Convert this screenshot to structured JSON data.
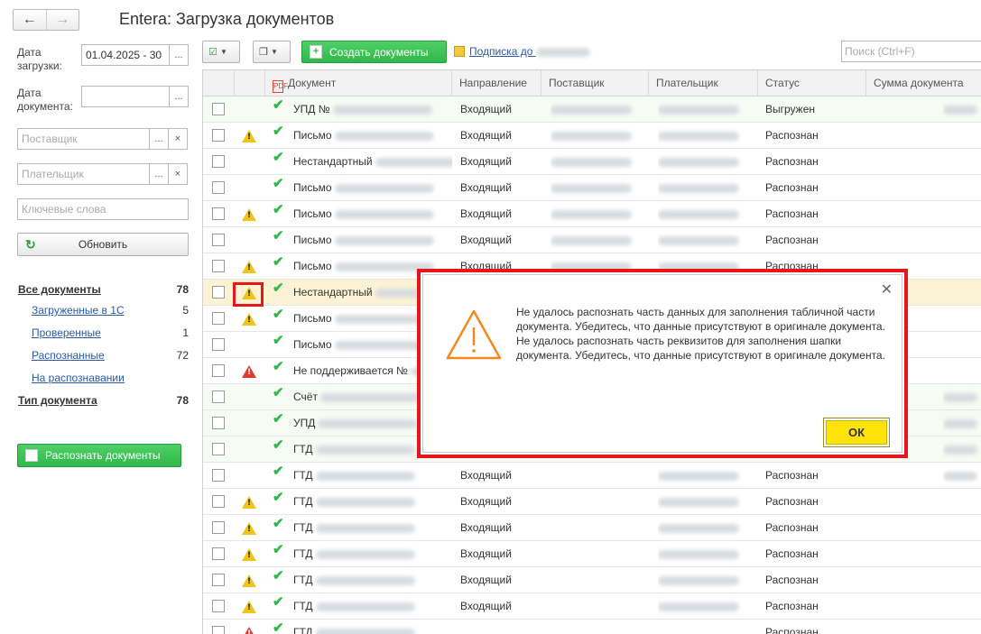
{
  "window": {
    "title": "Entera: Загрузка документов"
  },
  "filters": {
    "upload_date_label": "Дата загрузки:",
    "upload_date_value": "01.04.2025 - 30",
    "doc_date_label": "Дата документа:",
    "supplier_placeholder": "Поставщик",
    "payer_placeholder": "Плательщик",
    "keywords_placeholder": "Ключевые слова",
    "refresh_label": "Обновить"
  },
  "nav": {
    "all_docs": {
      "label": "Все документы",
      "count": "78"
    },
    "sub": [
      {
        "label": "Загруженные в 1С",
        "count": "5"
      },
      {
        "label": "Проверенные",
        "count": "1"
      },
      {
        "label": "Распознанные",
        "count": "72"
      },
      {
        "label": "На распознавании",
        "count": ""
      }
    ],
    "doc_type": {
      "label": "Тип документа",
      "count": "78"
    }
  },
  "recognize_button": "Распознать документы",
  "toolbar": {
    "create_label": "Создать документы",
    "subscription_label": "Подписка до",
    "search_placeholder": "Поиск (Ctrl+F)"
  },
  "table": {
    "columns": [
      "Документ",
      "Направление",
      "Поставщик",
      "Плательщик",
      "Статус",
      "Сумма документа"
    ],
    "rows": [
      {
        "doc": "УПД №",
        "dir": "Входящий",
        "status": "Выгружен",
        "warn": "none"
      },
      {
        "doc": "Письмо",
        "dir": "Входящий",
        "status": "Распознан",
        "warn": "yellow"
      },
      {
        "doc": "Нестандартный",
        "dir": "Входящий",
        "status": "Распознан",
        "warn": "none"
      },
      {
        "doc": "Письмо",
        "dir": "Входящий",
        "status": "Распознан",
        "warn": "none"
      },
      {
        "doc": "Письмо",
        "dir": "Входящий",
        "status": "Распознан",
        "warn": "yellow"
      },
      {
        "doc": "Письмо",
        "dir": "Входящий",
        "status": "Распознан",
        "warn": "none"
      },
      {
        "doc": "Письмо",
        "dir": "Входящий",
        "status": "Распознан",
        "warn": "yellow"
      },
      {
        "doc": "Нестандартный",
        "dir": "",
        "status": "",
        "warn": "yellow"
      },
      {
        "doc": "Письмо",
        "dir": "",
        "status": "",
        "warn": "yellow"
      },
      {
        "doc": "Письмо",
        "dir": "",
        "status": "",
        "warn": "none"
      },
      {
        "doc": "Не поддерживается №",
        "dir": "",
        "status": "",
        "warn": "red"
      },
      {
        "doc": "Счёт",
        "dir": "",
        "status": "",
        "warn": "none"
      },
      {
        "doc": "УПД",
        "dir": "",
        "status": "",
        "warn": "none"
      },
      {
        "doc": "ГТД",
        "dir": "",
        "status": "",
        "warn": "none"
      },
      {
        "doc": "ГТД",
        "dir": "Входящий",
        "status": "Распознан",
        "warn": "none"
      },
      {
        "doc": "ГТД",
        "dir": "Входящий",
        "status": "Распознан",
        "warn": "yellow"
      },
      {
        "doc": "ГТД",
        "dir": "Входящий",
        "status": "Распознан",
        "warn": "yellow"
      },
      {
        "doc": "ГТД",
        "dir": "Входящий",
        "status": "Распознан",
        "warn": "yellow"
      },
      {
        "doc": "ГТД",
        "dir": "Входящий",
        "status": "Распознан",
        "warn": "yellow"
      },
      {
        "doc": "ГТД",
        "dir": "Входящий",
        "status": "Распознан",
        "warn": "yellow"
      },
      {
        "doc": "ГТД",
        "dir": "",
        "status": "Распознан",
        "warn": "red"
      }
    ]
  },
  "dialog": {
    "message_1": "Не удалось распознать часть данных для заполнения табличной части документа. Убедитесь, что данные присутствуют в оригинале документа.",
    "message_2": "Не удалось распознать часть реквизитов для заполнения шапки документа. Убедитесь, что данные присутствуют в оригинале документа.",
    "ok_label": "ОК"
  },
  "colors": {
    "accent_green": "#2fb84a",
    "highlight_red": "#e8151b",
    "ok_yellow": "#ffe30a",
    "warning_yellow": "#f0c419"
  }
}
